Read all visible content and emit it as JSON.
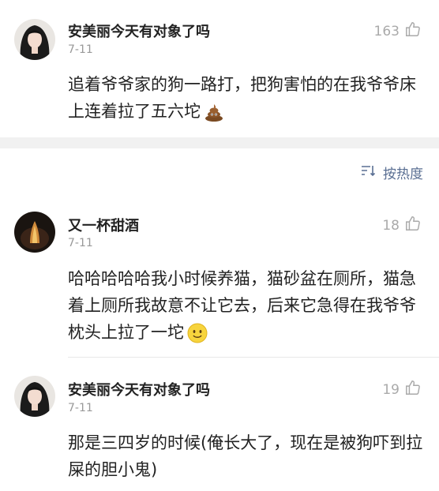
{
  "comments": [
    {
      "username": "安美丽今天有对象了吗",
      "date": "7-11",
      "likes": "163",
      "text": "追着爷爷家的狗一路打，把狗害怕的在我爷爷床上连着拉了五六坨",
      "emoji": "poop-emoji"
    },
    {
      "username": "又一杯甜酒",
      "date": "7-11",
      "likes": "18",
      "text": "哈哈哈哈哈我小时候养猫，猫砂盆在厕所，猫急着上厕所我故意不让它去，后来它急得在我爷爷枕头上拉了一坨",
      "emoji": "smile-emoji"
    },
    {
      "username": "安美丽今天有对象了吗",
      "date": "7-11",
      "likes": "19",
      "text": "那是三四岁的时候(俺长大了，现在是被狗吓到拉屎的胆小鬼)"
    }
  ],
  "sort": {
    "label": "按热度",
    "icon": "sort-icon"
  }
}
